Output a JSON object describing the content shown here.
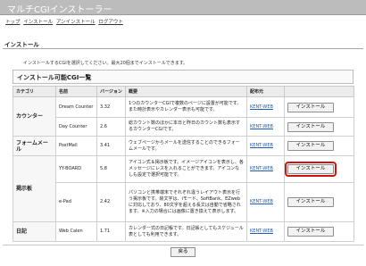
{
  "window": {
    "title": "マルチCGIインストーラー"
  },
  "nav": [
    "トップ",
    "インストール",
    "アンインストール",
    "ログアウト"
  ],
  "section": {
    "title": "インストール"
  },
  "intro": "インストールするCGIを選択してください。最大20個までインストールできます。",
  "table": {
    "title": "インストール可能CGI一覧",
    "headers": {
      "category": "カテゴリ",
      "name": "名前",
      "version": "バージョン",
      "summary": "概要",
      "distributor": "配布元",
      "action": ""
    },
    "categories": [
      "カウンター",
      "フォームメール",
      "掲示板",
      "日記"
    ],
    "rows": [
      {
        "name": "Dream Counter",
        "version": "3.32",
        "summary": "1つのカウンターCGIで複数のページに設置が可能です。また時計表示やカレンダー表示も可能です。",
        "distributor": "KENT-WEB",
        "action": "インストール"
      },
      {
        "name": "Day Counter",
        "version": "2.6",
        "summary": "総カウント数のほかに本日と昨日のカウント数も表示するカウンターCGIです。",
        "distributor": "KENT-WEB",
        "action": "インストール"
      },
      {
        "name": "PostMail",
        "version": "3.41",
        "summary": "ウェブページからメールを送信することのできるフォームメールです。",
        "distributor": "KENT-WEB",
        "action": "インストール"
      },
      {
        "name": "YY-BOARD",
        "version": "5.8",
        "summary": "アイコン式＆掲示板です。イメージアイコンを表示し、各メッセージにレスを入れることができます。アイコンなしも設定で選択可能です。",
        "distributor": "KENT-WEB",
        "action": "インストール"
      },
      {
        "name": "e-Pad",
        "version": "2.42",
        "summary": "パソコンと携帯端末でそれぞれ違うレイアウト表示を行う掲示板です。絵文字は、iモード、SoftBank、EZwebに対応しており、80文字を超える長文は自動で省略されます。※入力の場合には画像に置き換えて表示します。",
        "distributor": "KENT-WEB",
        "action": "インストール"
      },
      {
        "name": "Web Calen",
        "version": "1.71",
        "summary": "カレンダー式の日記帳です。日記帳としてもスケジュール表としても利用できます。",
        "distributor": "KENT-WEB",
        "action": "インストール"
      }
    ]
  },
  "footer": {
    "back_label": "戻る"
  },
  "colors": {
    "title_bar": "#bcbcbc",
    "highlight": "#d11010",
    "link": "#1c5bb8"
  }
}
